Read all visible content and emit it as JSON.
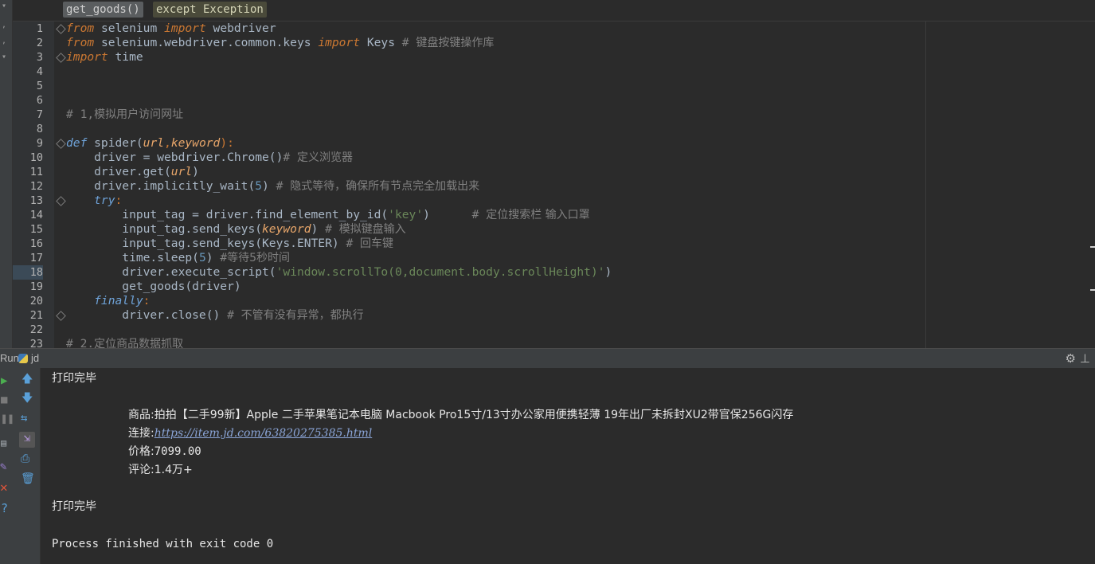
{
  "breadcrumb": {
    "item1": "get_goods()",
    "item2": "except Exception"
  },
  "gutter": {
    "line_numbers": [
      "1",
      "2",
      "3",
      "4",
      "5",
      "6",
      "7",
      "8",
      "9",
      "10",
      "11",
      "12",
      "13",
      "14",
      "15",
      "16",
      "17",
      "18",
      "19",
      "20",
      "21",
      "22",
      "23"
    ],
    "active_line": "18"
  },
  "code": {
    "l1": {
      "kw1": "from",
      "mod": " selenium ",
      "kw2": "import",
      "name": " webdriver"
    },
    "l2": {
      "kw1": "from",
      "mod": " selenium.webdriver.common.keys ",
      "kw2": "import",
      "name": " Keys ",
      "comment_hash": "# ",
      "comment": "键盘按键操作库"
    },
    "l3": {
      "kw1": "import",
      "name": " time"
    },
    "l7": {
      "comment_hash": "# 1,",
      "comment": "模拟用户访问网址"
    },
    "l9": {
      "kw": "def",
      "fn": " spider(",
      "p1": "url",
      "comma": ",",
      "p2": "keyword",
      "end": "):"
    },
    "l10": {
      "code": "    driver = webdriver.Chrome()",
      "comment_hash": "# ",
      "comment": "定义浏览器"
    },
    "l11": {
      "code": "    driver.get(",
      "p": "url",
      "end": ")"
    },
    "l12": {
      "code": "    driver.implicitly_wait(",
      "num": "5",
      "end": ") ",
      "comment_hash": "# ",
      "comment": "隐式等待，确保所有节点完全加载出来"
    },
    "l13": {
      "kw": "    try",
      "end": ":"
    },
    "l14": {
      "code": "        input_tag = driver.find_element_by_id(",
      "str": "'key'",
      "end": ")      ",
      "comment_hash": "# ",
      "comment": "定位搜索栏 输入口罩"
    },
    "l15": {
      "code": "        input_tag.send_keys(",
      "p": "keyword",
      "end": ") ",
      "comment_hash": "# ",
      "comment": "模拟键盘输入"
    },
    "l16": {
      "code": "        input_tag.send_keys(Keys.ENTER) ",
      "comment_hash": "# ",
      "comment": "回车键"
    },
    "l17": {
      "code": "        time.sleep(",
      "num": "5",
      "end": ") ",
      "comment_hash": "#",
      "comment": "等待5秒时间"
    },
    "l18": {
      "code": "        driver.execute_script(",
      "str": "'window.scrollTo(0,document.body.scrollHeight)'",
      "end": ")"
    },
    "l19": {
      "code": "        get_goods(driver)"
    },
    "l20": {
      "kw": "    finally",
      "end": ":"
    },
    "l21": {
      "code": "        driver.close() ",
      "comment_hash": "# ",
      "comment": "不管有没有异常，都执行"
    },
    "l23": {
      "comment_hash": "# 2.",
      "comment": "定位商品数据抓取"
    }
  },
  "run_panel": {
    "label": "Run",
    "config": "jd"
  },
  "console": {
    "line1": "打印完毕",
    "product_label": "商品:",
    "product": "拍拍【二手99新】Apple 二手苹果笔记本电脑 Macbook Pro15寸/13寸办公家用便携轻薄 19年出厂未拆封XU2带官保256G闪存",
    "link_label": "连接:",
    "link": "https://item.jd.com/63820275385.html",
    "price_label": "价格:",
    "price": "7099.00",
    "comment_label": "评论:",
    "comments": "1.4万+",
    "line2": "打印完毕",
    "exit": "Process finished with exit code 0"
  },
  "icons": {
    "run": "play-icon",
    "stop": "stop-icon",
    "pause": "pause-icon",
    "up": "arrow-up-icon",
    "down": "arrow-down-icon",
    "wrap": "soft-wrap-icon",
    "scroll": "scroll-to-end-icon",
    "print": "print-icon",
    "trash": "trash-icon",
    "settings": "gear-icon",
    "pin": "pin-icon",
    "close": "close-icon",
    "help": "help-icon"
  },
  "colors": {
    "editor_bg": "#2b2b2b",
    "keyword": "#cc7832",
    "comment": "#808080",
    "string": "#6a8759",
    "number": "#6897bb",
    "param": "#e8a66a"
  }
}
